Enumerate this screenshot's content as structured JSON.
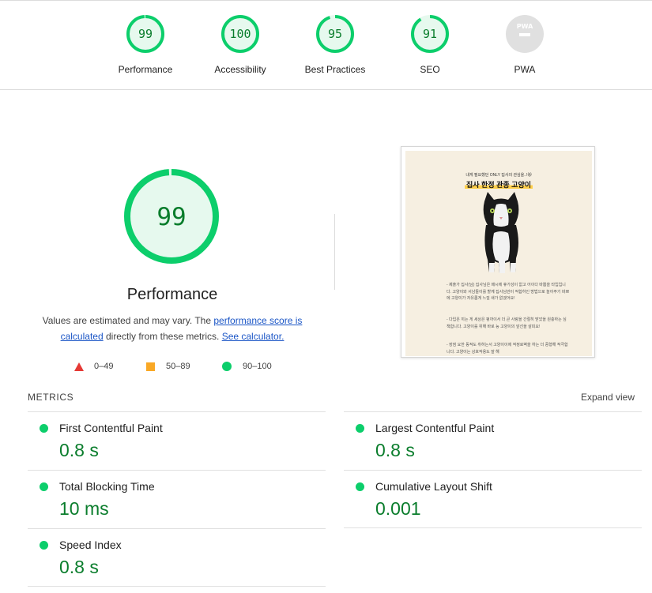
{
  "categories": [
    {
      "label": "Performance",
      "score": "99",
      "value": 99
    },
    {
      "label": "Accessibility",
      "score": "100",
      "value": 100
    },
    {
      "label": "Best Practices",
      "score": "95",
      "value": 95
    },
    {
      "label": "SEO",
      "score": "91",
      "value": 91
    },
    {
      "label": "PWA",
      "score": "",
      "value": null,
      "badge": "PWA"
    }
  ],
  "performance": {
    "score": "99",
    "value": 99,
    "title": "Performance",
    "desc_start": "Values are estimated and may vary. The ",
    "desc_link1": "performance score is calculated",
    "desc_middle": " directly from these metrics. ",
    "desc_link2": "See calculator."
  },
  "legend": {
    "fail": "0–49",
    "average": "50–89",
    "pass": "90–100"
  },
  "thumbnail": {
    "subtitle": "내게 필요했던 ONLY 집사의 관심을..!😻",
    "title": "집사 한정 관종 고양이",
    "para1": "- 제출가 집사(님) 집사님은 매시에 휴가성이 없고 어이다 바쁨을 타입입니다. 고양이와 서남들이를 할께 집사님만이 적합하인 방법으로 놀아주기 바쁘에 고양이가 자유롭게 느낄 새가 없겠어요!",
    "para2": "- 다입은 끼는 게 세상은 펑까이서 더 큰 사랑을 간절히 받았을 원충하는 심책합니다. 고양이를 위해 바로 능 고양이의 앞선을 살피요!",
    "para3": "- 장점 요한 동적도 취하는서 고양이이에 적정로벽을 하는 더 중형해 적극합니다. 고양이는 상호작용도 잘 해"
  },
  "metrics": {
    "header": "METRICS",
    "expand": "Expand view",
    "items": [
      {
        "label": "First Contentful Paint",
        "value": "0.8 s"
      },
      {
        "label": "Largest Contentful Paint",
        "value": "0.8 s"
      },
      {
        "label": "Total Blocking Time",
        "value": "10 ms"
      },
      {
        "label": "Cumulative Layout Shift",
        "value": "0.001"
      },
      {
        "label": "Speed Index",
        "value": "0.8 s"
      }
    ]
  },
  "colors": {
    "pass": "#0cce6b",
    "pass_text": "#0a7d2c",
    "pass_fill": "#e6f9ee",
    "average": "#f9a825",
    "fail": "#e53935",
    "na": "#e0e0e0"
  }
}
